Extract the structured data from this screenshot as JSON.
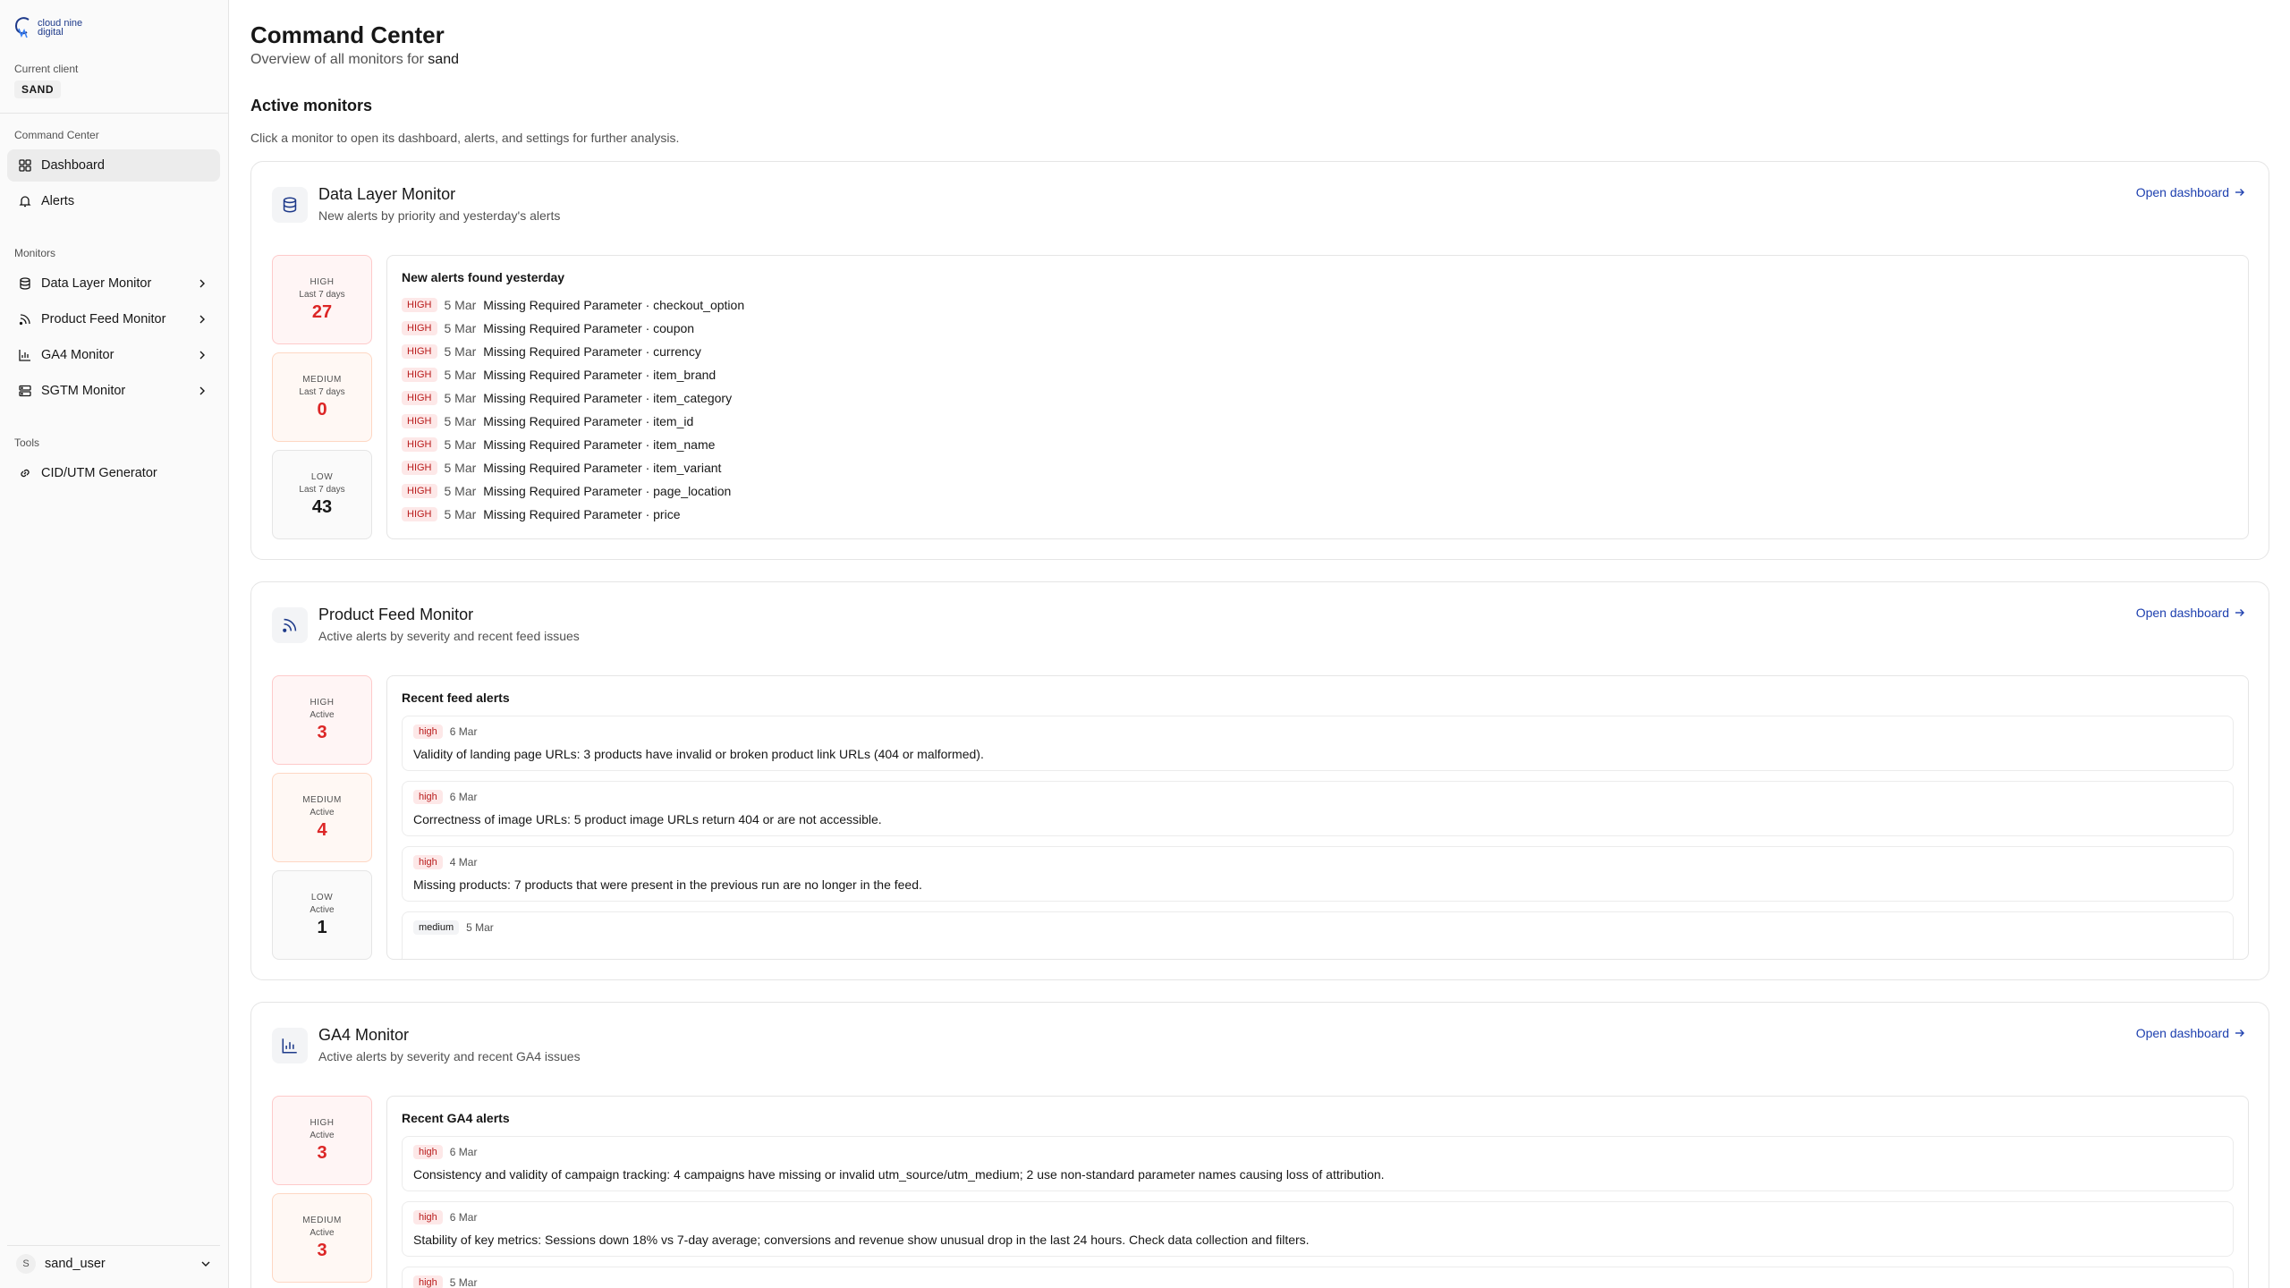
{
  "sidebar": {
    "logo_line1": "cloud nine",
    "logo_line2": "digital",
    "current_client_label": "Current client",
    "client_name": "SAND",
    "section_command": "Command Center",
    "dashboard": "Dashboard",
    "alerts": "Alerts",
    "section_monitors": "Monitors",
    "monitors": [
      "Data Layer Monitor",
      "Product Feed Monitor",
      "GA4 Monitor",
      "SGTM Monitor"
    ],
    "section_tools": "Tools",
    "tool_cid": "CID/UTM Generator",
    "user_initial": "S",
    "username": "sand_user"
  },
  "page": {
    "title": "Command Center",
    "subtitle_prefix": "Overview of all monitors for",
    "subtitle_client": "sand",
    "section_title": "Active monitors",
    "section_desc": "Click a monitor to open its dashboard, alerts, and settings for further analysis."
  },
  "open_dashboard": "Open dashboard",
  "data_layer": {
    "title": "Data Layer Monitor",
    "desc": "New alerts by priority and yesterday's alerts",
    "stats": [
      {
        "level": "HIGH",
        "period": "Last 7 days",
        "value": "27"
      },
      {
        "level": "MEDIUM",
        "period": "Last 7 days",
        "value": "0"
      },
      {
        "level": "LOW",
        "period": "Last 7 days",
        "value": "43"
      }
    ],
    "panel_title": "New alerts found yesterday",
    "rows": [
      {
        "tag": "HIGH",
        "date": "5 Mar",
        "text": "Missing Required Parameter · checkout_option"
      },
      {
        "tag": "HIGH",
        "date": "5 Mar",
        "text": "Missing Required Parameter · coupon"
      },
      {
        "tag": "HIGH",
        "date": "5 Mar",
        "text": "Missing Required Parameter · currency"
      },
      {
        "tag": "HIGH",
        "date": "5 Mar",
        "text": "Missing Required Parameter · item_brand"
      },
      {
        "tag": "HIGH",
        "date": "5 Mar",
        "text": "Missing Required Parameter · item_category"
      },
      {
        "tag": "HIGH",
        "date": "5 Mar",
        "text": "Missing Required Parameter · item_id"
      },
      {
        "tag": "HIGH",
        "date": "5 Mar",
        "text": "Missing Required Parameter · item_name"
      },
      {
        "tag": "HIGH",
        "date": "5 Mar",
        "text": "Missing Required Parameter · item_variant"
      },
      {
        "tag": "HIGH",
        "date": "5 Mar",
        "text": "Missing Required Parameter · page_location"
      },
      {
        "tag": "HIGH",
        "date": "5 Mar",
        "text": "Missing Required Parameter · price"
      }
    ]
  },
  "product_feed": {
    "title": "Product Feed Monitor",
    "desc": "Active alerts by severity and recent feed issues",
    "stats": [
      {
        "level": "HIGH",
        "period": "Active",
        "value": "3"
      },
      {
        "level": "MEDIUM",
        "period": "Active",
        "value": "4"
      },
      {
        "level": "LOW",
        "period": "Active",
        "value": "1"
      }
    ],
    "panel_title": "Recent feed alerts",
    "alerts": [
      {
        "tag": "high",
        "date": "6 Mar",
        "text": "Validity of landing page URLs: 3 products have invalid or broken product link URLs (404 or malformed)."
      },
      {
        "tag": "high",
        "date": "6 Mar",
        "text": "Correctness of image URLs: 5 product image URLs return 404 or are not accessible."
      },
      {
        "tag": "high",
        "date": "4 Mar",
        "text": "Missing products: 7 products that were present in the previous run are no longer in the feed."
      },
      {
        "tag": "medium",
        "date": "5 Mar",
        "text": ""
      }
    ]
  },
  "ga4": {
    "title": "GA4 Monitor",
    "desc": "Active alerts by severity and recent GA4 issues",
    "stats": [
      {
        "level": "HIGH",
        "period": "Active",
        "value": "3"
      },
      {
        "level": "MEDIUM",
        "period": "Active",
        "value": "3"
      }
    ],
    "panel_title": "Recent GA4 alerts",
    "alerts": [
      {
        "tag": "high",
        "date": "6 Mar",
        "text": "Consistency and validity of campaign tracking: 4 campaigns have missing or invalid utm_source/utm_medium; 2 use non-standard parameter names causing loss of attribution."
      },
      {
        "tag": "high",
        "date": "6 Mar",
        "text": "Stability of key metrics: Sessions down 18% vs 7-day average; conversions and revenue show unusual drop in the last 24 hours. Check data collection and filters."
      },
      {
        "tag": "high",
        "date": "5 Mar",
        "text": ""
      }
    ]
  }
}
